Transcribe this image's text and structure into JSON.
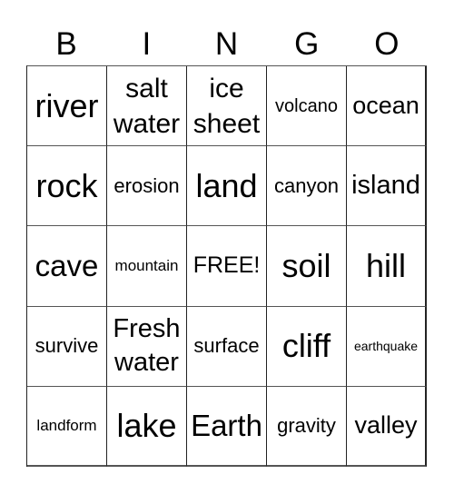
{
  "header": {
    "letters": [
      "B",
      "I",
      "N",
      "G",
      "O"
    ]
  },
  "grid": {
    "rows": [
      [
        "river",
        "salt\nwater",
        "ice\nsheet",
        "volcano",
        "ocean"
      ],
      [
        "rock",
        "erosion",
        "land",
        "canyon",
        "island"
      ],
      [
        "cave",
        "mountain",
        "FREE!",
        "soil",
        "hill"
      ],
      [
        "survive",
        "Fresh\nwater",
        "surface",
        "cliff",
        "earthquake"
      ],
      [
        "landform",
        "lake",
        "Earth",
        "gravity",
        "valley"
      ]
    ]
  }
}
